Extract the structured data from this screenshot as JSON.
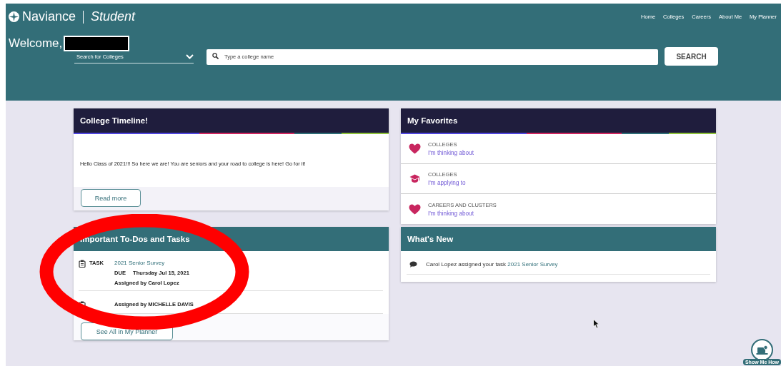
{
  "header": {
    "brand": "Naviance",
    "product": "Student",
    "nav": [
      "Home",
      "Colleges",
      "Careers",
      "About Me",
      "My Planner"
    ],
    "welcome": "Welcome,",
    "search_type": "Search for Colleges",
    "search_placeholder": "Type a college name",
    "search_button": "SEARCH"
  },
  "timeline": {
    "title": "College Timeline!",
    "text": "Hello Class of 2021!!! So here we are! You are seniors and your road to college is here! Go for it!",
    "button": "Read more"
  },
  "favorites": {
    "title": "My Favorites",
    "items": [
      {
        "kind": "favorite",
        "category": "COLLEGES",
        "link": "I'm thinking about"
      },
      {
        "kind": "applied",
        "category": "COLLEGES",
        "link": "I'm applying to"
      },
      {
        "kind": "favorite",
        "category": "CAREERS AND CLUSTERS",
        "link": "I'm thinking about"
      }
    ]
  },
  "tasks": {
    "title": "Important To-Dos and Tasks",
    "items": [
      {
        "label": "TASK",
        "title": "2021 Senior Survey",
        "due_label": "DUE",
        "due": "Thursday Jul 15, 2021",
        "assigned": "Assigned by Carol Lopez"
      },
      {
        "assigned": "Assigned by MICHELLE DAVIS"
      }
    ],
    "button": "See All in My Planner"
  },
  "whats_new": {
    "title": "What's New",
    "items": [
      {
        "text": "Carol Lopez assigned your task ",
        "link": "2021 Senior Survey"
      }
    ]
  },
  "help": {
    "label": "Show Me How"
  }
}
